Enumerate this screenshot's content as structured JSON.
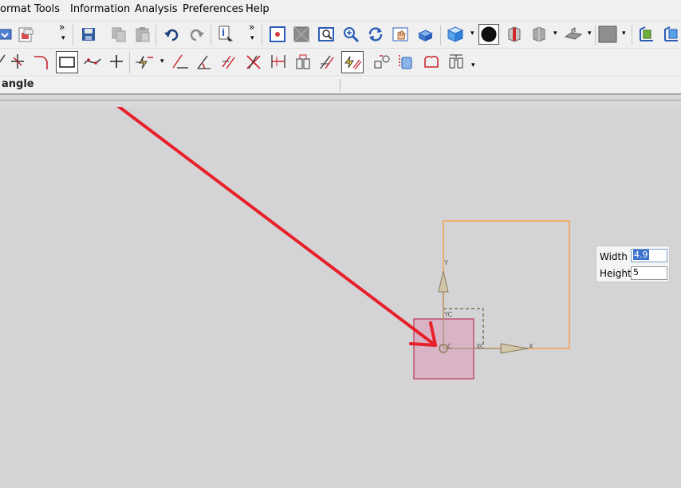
{
  "menu": {
    "items": [
      "ormat",
      "Tools",
      "Information",
      "Analysis",
      "Preferences",
      "Help"
    ]
  },
  "status": {
    "text": "angle"
  },
  "toolbar": {
    "overflow_glyph": "»",
    "dropdown_glyph": "▾"
  },
  "canvas": {
    "axes": {
      "y_label": "Y",
      "x_label": "X",
      "yc_label": "YC",
      "xc_label": "XC",
      "c_label": "C"
    },
    "colors": {
      "arrow": "#e8202a",
      "preview_rect": "#f5a04a",
      "placed_rect_fill": "#d8b4c4",
      "placed_rect_stroke": "#c0506e",
      "axis": "#a89070"
    }
  },
  "dimension_dialog": {
    "width_label": "Width",
    "width_value": "4.9",
    "height_label": "Height",
    "height_value": "5"
  }
}
